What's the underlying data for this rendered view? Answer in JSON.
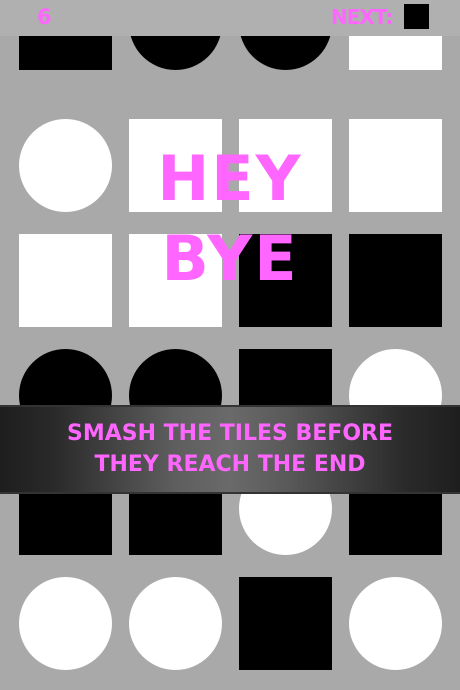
{
  "hud": {
    "score": "6",
    "next_label": "NEXT:",
    "next_tile": "black-square"
  },
  "overlay": {
    "line1": "HEY",
    "line2": "BYE"
  },
  "banner": {
    "line1": "SMASH THE TILES BEFORE",
    "line2": "THEY REACH THE END"
  },
  "board": {
    "columns": 4,
    "rows": [
      [
        "black-square",
        "black-circle",
        "black-circle",
        "white-square"
      ],
      [
        "white-circle",
        "white-square",
        "white-square",
        "white-square"
      ],
      [
        "white-square",
        "white-square",
        "black-square",
        "black-square"
      ],
      [
        "black-circle",
        "black-circle",
        "black-square",
        "white-circle"
      ],
      [
        "black-square",
        "black-square",
        "white-circle",
        "black-square"
      ],
      [
        "white-circle",
        "white-circle",
        "black-square",
        "white-circle"
      ]
    ]
  },
  "colors": {
    "accent": "#ff66ff",
    "background": "#a9a9a9",
    "tile_dark": "#000000",
    "tile_light": "#ffffff"
  }
}
